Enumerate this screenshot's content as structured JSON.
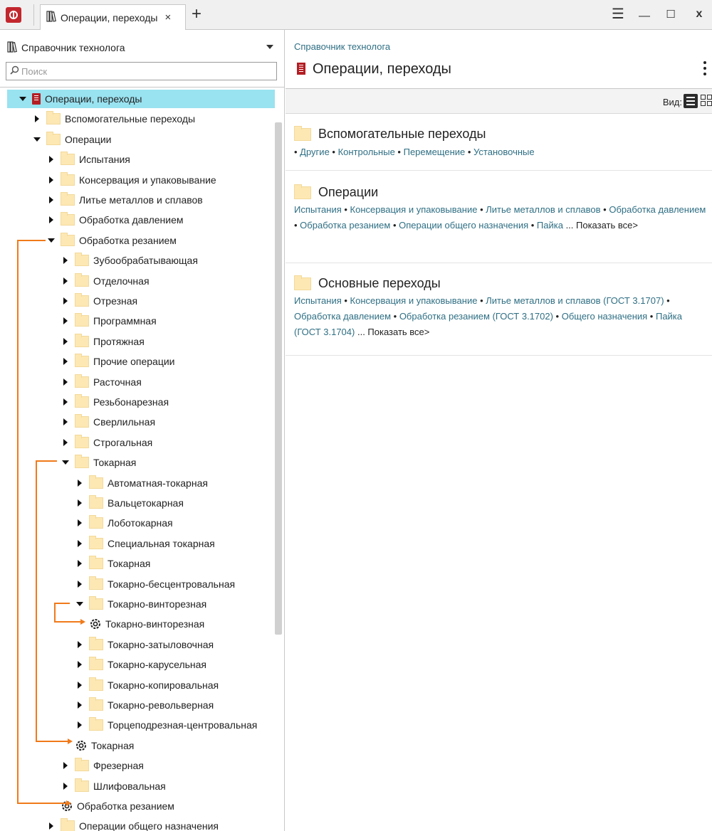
{
  "titlebar": {
    "tab_label": "Операции, переходы",
    "tab_close": "×",
    "add_tab": "+",
    "menu": "☰",
    "minimize": "—",
    "maximize": "☐",
    "close": "x"
  },
  "sidebar": {
    "library_name": "Справочник технолога",
    "search_placeholder": "Поиск",
    "tree": [
      {
        "label": "Операции, переходы",
        "level": 0,
        "type": "book",
        "expand": "down",
        "selected": true
      },
      {
        "label": "Вспомогательные переходы",
        "level": 1,
        "type": "folder",
        "expand": "right"
      },
      {
        "label": "Операции",
        "level": 1,
        "type": "folder",
        "expand": "down"
      },
      {
        "label": "Испытания",
        "level": 2,
        "type": "folder",
        "expand": "right"
      },
      {
        "label": "Консервация и упаковывание",
        "level": 2,
        "type": "folder",
        "expand": "right"
      },
      {
        "label": "Литье металлов и сплавов",
        "level": 2,
        "type": "folder",
        "expand": "right"
      },
      {
        "label": "Обработка давлением",
        "level": 2,
        "type": "folder",
        "expand": "right"
      },
      {
        "label": "Обработка резанием",
        "level": 2,
        "type": "folder",
        "expand": "down"
      },
      {
        "label": "Зубообрабатывающая",
        "level": 3,
        "type": "folder",
        "expand": "right"
      },
      {
        "label": "Отделочная",
        "level": 3,
        "type": "folder",
        "expand": "right"
      },
      {
        "label": "Отрезная",
        "level": 3,
        "type": "folder",
        "expand": "right"
      },
      {
        "label": "Программная",
        "level": 3,
        "type": "folder",
        "expand": "right"
      },
      {
        "label": "Протяжная",
        "level": 3,
        "type": "folder",
        "expand": "right"
      },
      {
        "label": "Прочие операции",
        "level": 3,
        "type": "folder",
        "expand": "right"
      },
      {
        "label": "Расточная",
        "level": 3,
        "type": "folder",
        "expand": "right"
      },
      {
        "label": "Резьбонарезная",
        "level": 3,
        "type": "folder",
        "expand": "right"
      },
      {
        "label": "Сверлильная",
        "level": 3,
        "type": "folder",
        "expand": "right"
      },
      {
        "label": "Строгальная",
        "level": 3,
        "type": "folder",
        "expand": "right"
      },
      {
        "label": "Токарная",
        "level": 3,
        "type": "folder",
        "expand": "down"
      },
      {
        "label": "Автоматная-токарная",
        "level": 4,
        "type": "folder",
        "expand": "right"
      },
      {
        "label": "Вальцетокарная",
        "level": 4,
        "type": "folder",
        "expand": "right"
      },
      {
        "label": "Лоботокарная",
        "level": 4,
        "type": "folder",
        "expand": "right"
      },
      {
        "label": "Специальная токарная",
        "level": 4,
        "type": "folder",
        "expand": "right"
      },
      {
        "label": "Токарная",
        "level": 4,
        "type": "folder",
        "expand": "right"
      },
      {
        "label": "Токарно-бесцентровальная",
        "level": 4,
        "type": "folder",
        "expand": "right"
      },
      {
        "label": "Токарно-винторезная",
        "level": 4,
        "type": "folder",
        "expand": "down"
      },
      {
        "label": "Токарно-винторезная",
        "level": 5,
        "type": "operation",
        "expand": "none"
      },
      {
        "label": "Токарно-затыловочная",
        "level": 4,
        "type": "folder",
        "expand": "right"
      },
      {
        "label": "Токарно-карусельная",
        "level": 4,
        "type": "folder",
        "expand": "right"
      },
      {
        "label": "Токарно-копировальная",
        "level": 4,
        "type": "folder",
        "expand": "right"
      },
      {
        "label": "Токарно-револьверная",
        "level": 4,
        "type": "folder",
        "expand": "right"
      },
      {
        "label": "Торцеподрезная-центровальная",
        "level": 4,
        "type": "folder",
        "expand": "right"
      },
      {
        "label": "Токарная",
        "level": 4,
        "type": "operation",
        "expand": "none"
      },
      {
        "label": "Фрезерная",
        "level": 3,
        "type": "folder",
        "expand": "right"
      },
      {
        "label": "Шлифовальная",
        "level": 3,
        "type": "folder",
        "expand": "right"
      },
      {
        "label": "Обработка резанием",
        "level": 3,
        "type": "operation",
        "expand": "none"
      },
      {
        "label": "Операции общего назначения",
        "level": 2,
        "type": "folder",
        "expand": "right"
      }
    ]
  },
  "main": {
    "breadcrumb": "Справочник технолога",
    "title": "Операции, переходы",
    "view_label": "Вид:",
    "sections": [
      {
        "title": "Вспомогательные переходы",
        "links": [
          "Другие",
          "Контрольные",
          "Перемещение",
          "Установочные"
        ],
        "leading_dot": true,
        "show_all": ""
      },
      {
        "title": "Операции",
        "links": [
          "Испытания",
          "Консервация и упаковывание",
          "Литье металлов и сплавов",
          "Обработка давлением",
          "Обработка резанием",
          "Операции общего назначения",
          "Пайка"
        ],
        "leading_dot": false,
        "show_all": "... Показать все>"
      },
      {
        "title": "Основные переходы",
        "links": [
          "Испытания",
          "Консервация и упаковывание",
          "Литье металлов и сплавов (ГОСТ 3.1707)",
          "Обработка давлением",
          "Обработка резанием (ГОСТ 3.1702)",
          "Общего назначения",
          "Пайка (ГОСТ 3.1704)"
        ],
        "leading_dot": false,
        "show_all": "... Показать все>"
      }
    ]
  },
  "colors": {
    "accent_selected": "#99e2f0",
    "link": "#2f6f84",
    "connector": "#f07a1a",
    "brand": "#c2272d"
  }
}
